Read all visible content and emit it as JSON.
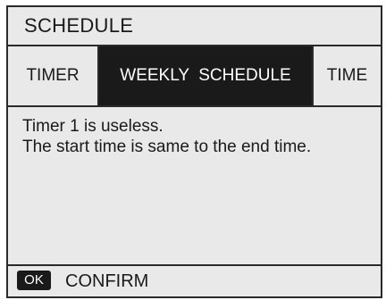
{
  "header": {
    "title": "SCHEDULE"
  },
  "tabs": [
    {
      "label": "TIMER",
      "selected": false
    },
    {
      "label": "WEEKLY  SCHEDULE",
      "selected": true
    },
    {
      "label": "TIME",
      "selected": false
    }
  ],
  "message": {
    "line1": "Timer 1 is useless.",
    "line2": "The start time is same to the end time."
  },
  "footer": {
    "ok_badge": "OK",
    "action_label": "CONFIRM"
  },
  "colors": {
    "background": "#e9e9e9",
    "border": "#2a2a2a",
    "selected_tab": "#1a1a1a",
    "selected_text": "#ffffff"
  }
}
